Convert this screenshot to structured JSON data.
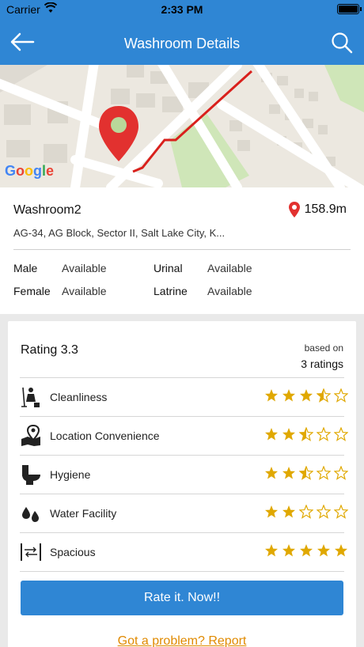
{
  "status_bar": {
    "carrier": "Carrier",
    "time": "2:33 PM"
  },
  "nav": {
    "title": "Washroom Details",
    "back_icon": "back-arrow-icon",
    "search_icon": "search-icon"
  },
  "map": {
    "brand": "Google"
  },
  "washroom": {
    "name": "Washroom2",
    "distance": "158.9m",
    "address": "AG-34, AG Block, Sector II, Salt Lake City, K...",
    "facilities": [
      {
        "label": "Male",
        "status": "Available"
      },
      {
        "label": "Urinal",
        "status": "Available"
      },
      {
        "label": "Female",
        "status": "Available"
      },
      {
        "label": "Latrine",
        "status": "Available"
      }
    ]
  },
  "ratings": {
    "title": "Rating 3.3",
    "based_on": "based on",
    "count": "3 ratings",
    "categories": [
      {
        "label": "Cleanliness",
        "icon": "cleaning-person-icon",
        "stars": 3.5
      },
      {
        "label": "Location Convenience",
        "icon": "map-pin-icon",
        "stars": 2.5
      },
      {
        "label": "Hygiene",
        "icon": "toilet-icon",
        "stars": 2.5
      },
      {
        "label": "Water Facility",
        "icon": "water-drops-icon",
        "stars": 2
      },
      {
        "label": "Spacious",
        "icon": "width-arrows-icon",
        "stars": 5
      }
    ],
    "rate_button": "Rate it. Now!!",
    "report_link": "Got a problem? Report"
  },
  "colors": {
    "accent": "#2f86d4",
    "star": "#e0a800",
    "link": "#e08a00",
    "pin": "#e2312f"
  }
}
